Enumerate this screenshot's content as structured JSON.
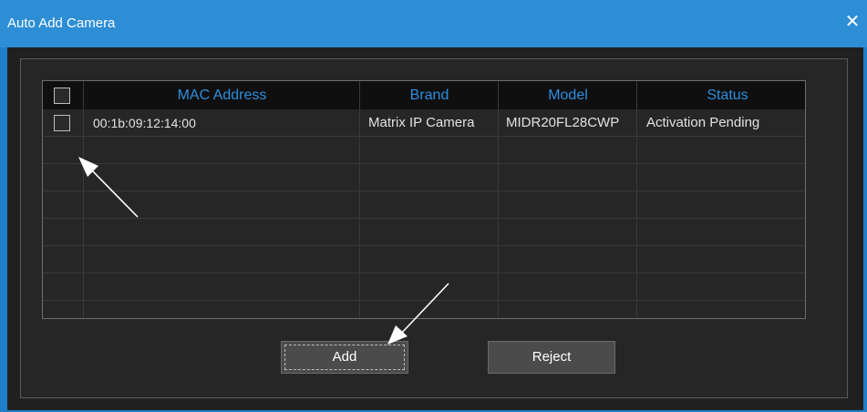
{
  "window": {
    "title": "Auto Add Camera"
  },
  "table": {
    "headers": {
      "mac": "MAC Address",
      "brand": "Brand",
      "model": "Model",
      "status": "Status"
    },
    "rows": [
      {
        "mac": "00:1b:09:12:14:00",
        "brand": "Matrix IP Camera",
        "model": "MIDR20FL28CWP",
        "status": "Activation Pending"
      }
    ]
  },
  "buttons": {
    "add": "Add",
    "reject": "Reject"
  },
  "icons": {
    "close": "close-icon",
    "arrows": "annotation-arrow"
  },
  "colors": {
    "titlebar": "#2d8ed6",
    "header_text": "#2e8fe0",
    "background": "#202020"
  }
}
